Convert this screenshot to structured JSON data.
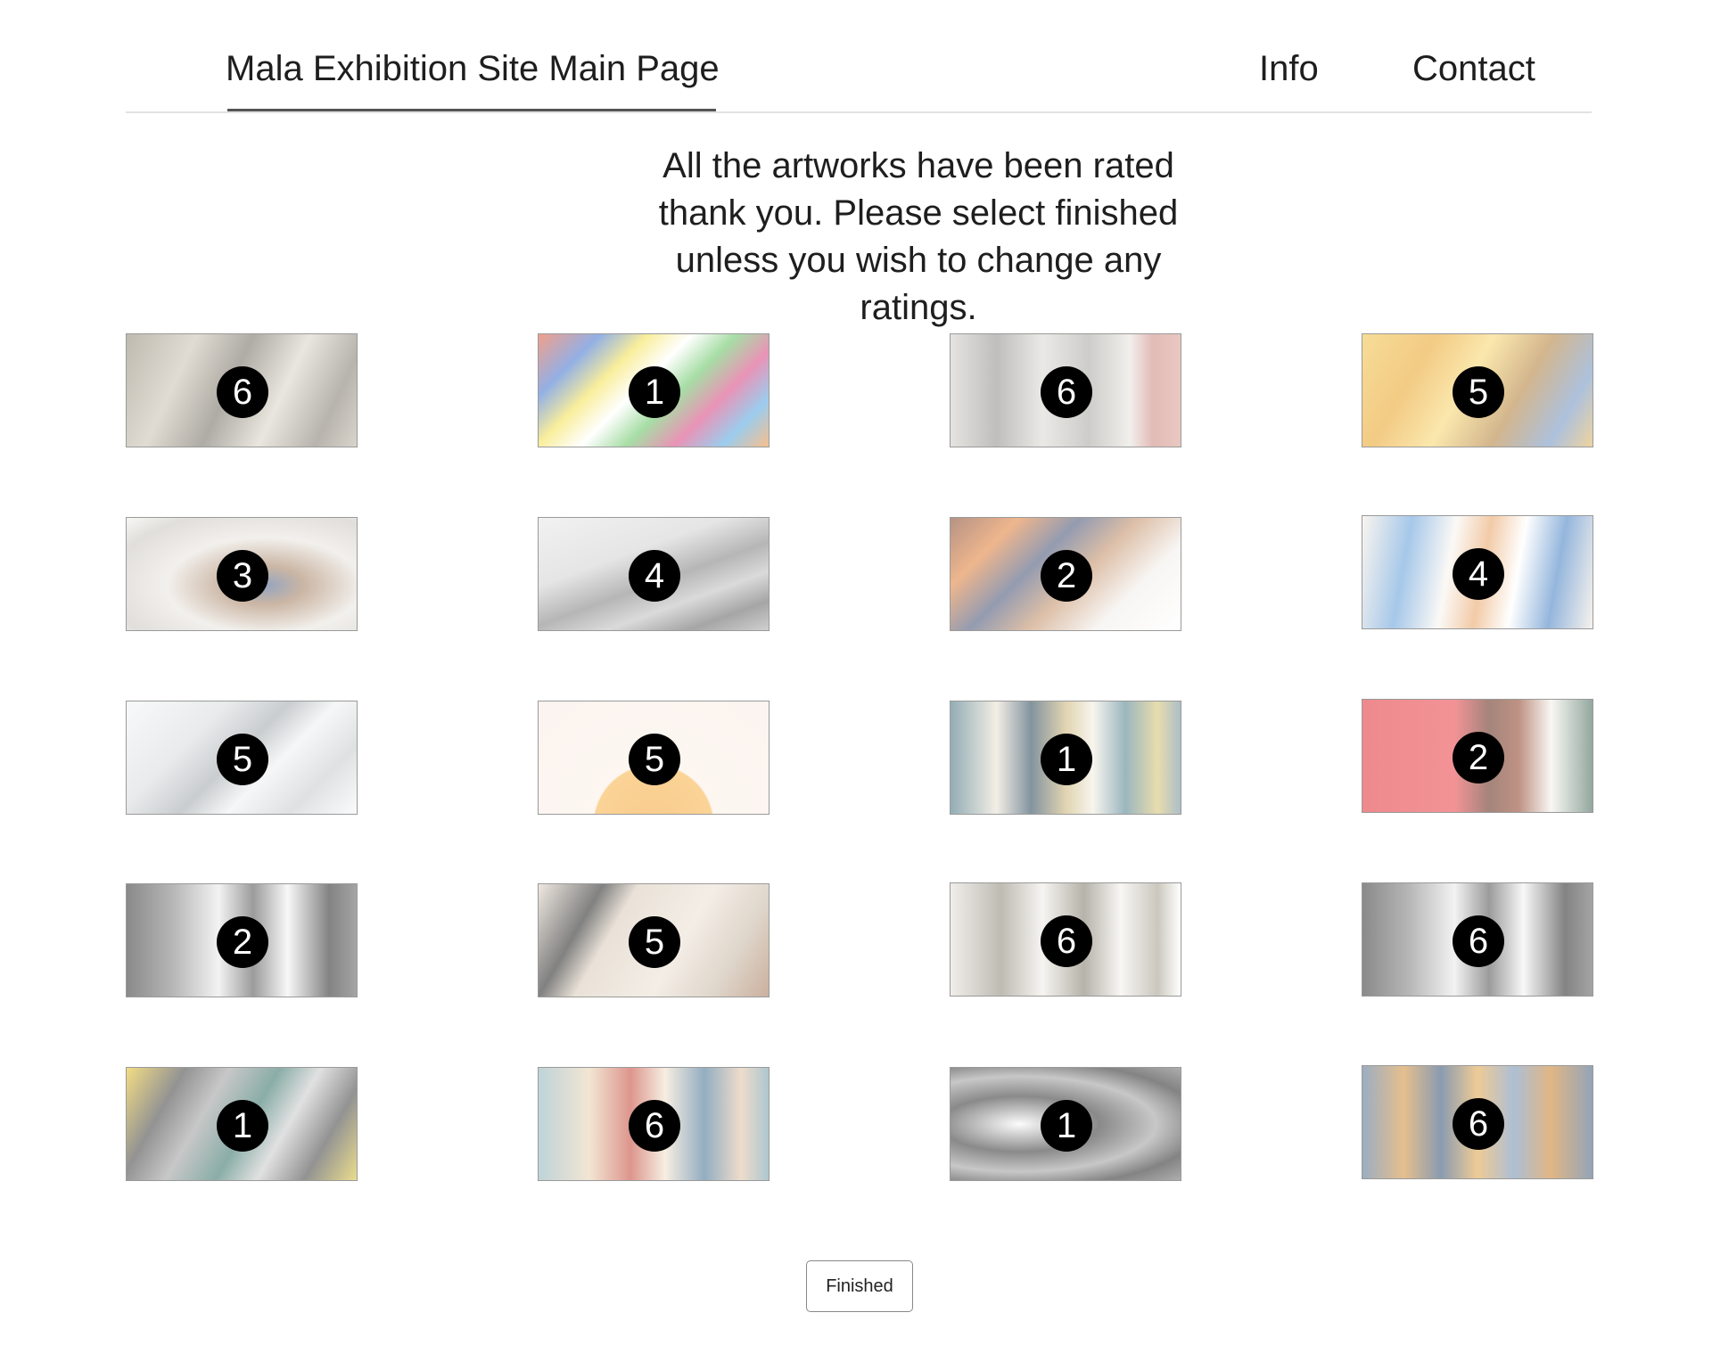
{
  "header": {
    "site_title": "Mala Exhibition Site Main Page",
    "nav": {
      "info": "Info",
      "contact": "Contact"
    }
  },
  "message": "All the artworks have been rated thank you. Please select finished unless you wish to change any ratings.",
  "artworks": [
    {
      "rating": "6"
    },
    {
      "rating": "1"
    },
    {
      "rating": "6"
    },
    {
      "rating": "5"
    },
    {
      "rating": "3"
    },
    {
      "rating": "4"
    },
    {
      "rating": "2"
    },
    {
      "rating": "4"
    },
    {
      "rating": "5"
    },
    {
      "rating": "5"
    },
    {
      "rating": "1"
    },
    {
      "rating": "2"
    },
    {
      "rating": "2"
    },
    {
      "rating": "5"
    },
    {
      "rating": "6"
    },
    {
      "rating": "6"
    },
    {
      "rating": "1"
    },
    {
      "rating": "6"
    },
    {
      "rating": "1"
    },
    {
      "rating": "6"
    }
  ],
  "finished_button": "Finished"
}
